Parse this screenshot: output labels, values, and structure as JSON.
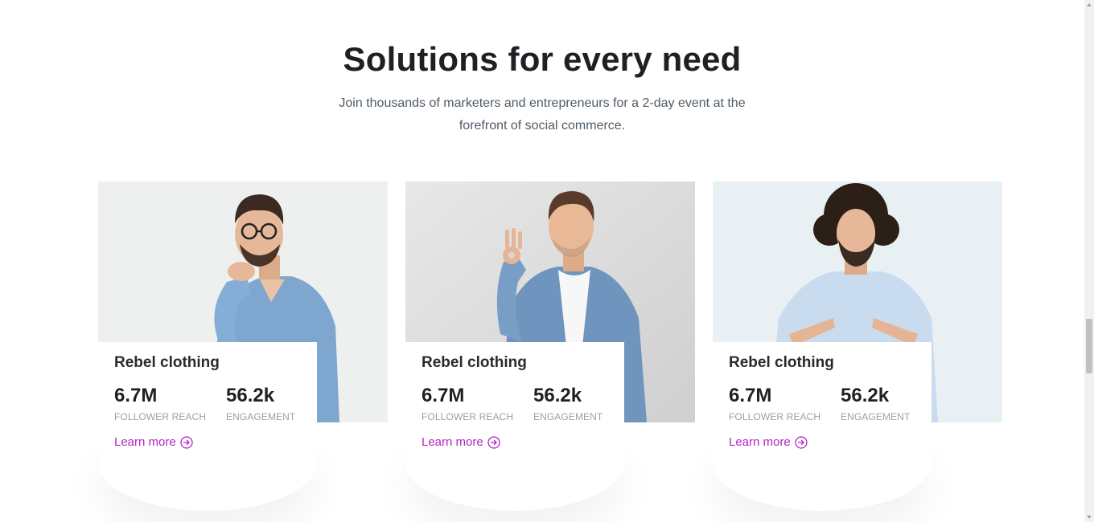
{
  "section": {
    "title": "Solutions for every need",
    "subtitle": "Join thousands of marketers and entrepreneurs for a 2-day event at the forefront of social commerce."
  },
  "cards": [
    {
      "title": "Rebel clothing",
      "stats": [
        {
          "value": "6.7M",
          "label": "FOLLOWER REACH"
        },
        {
          "value": "56.2k",
          "label": "ENGAGEMENT"
        }
      ],
      "link": "Learn more",
      "photo": "man-with-glasses-thinking"
    },
    {
      "title": "Rebel clothing",
      "stats": [
        {
          "value": "6.7M",
          "label": "FOLLOWER REACH"
        },
        {
          "value": "56.2k",
          "label": "ENGAGEMENT"
        }
      ],
      "link": "Learn more",
      "photo": "man-ok-gesture"
    },
    {
      "title": "Rebel clothing",
      "stats": [
        {
          "value": "6.7M",
          "label": "FOLLOWER REACH"
        },
        {
          "value": "56.2k",
          "label": "ENGAGEMENT"
        }
      ],
      "link": "Learn more",
      "photo": "man-pointing-at-self"
    }
  ],
  "colors": {
    "accent": "#b126c2",
    "heading": "#1f1f24",
    "muted": "#9aa0a6"
  }
}
